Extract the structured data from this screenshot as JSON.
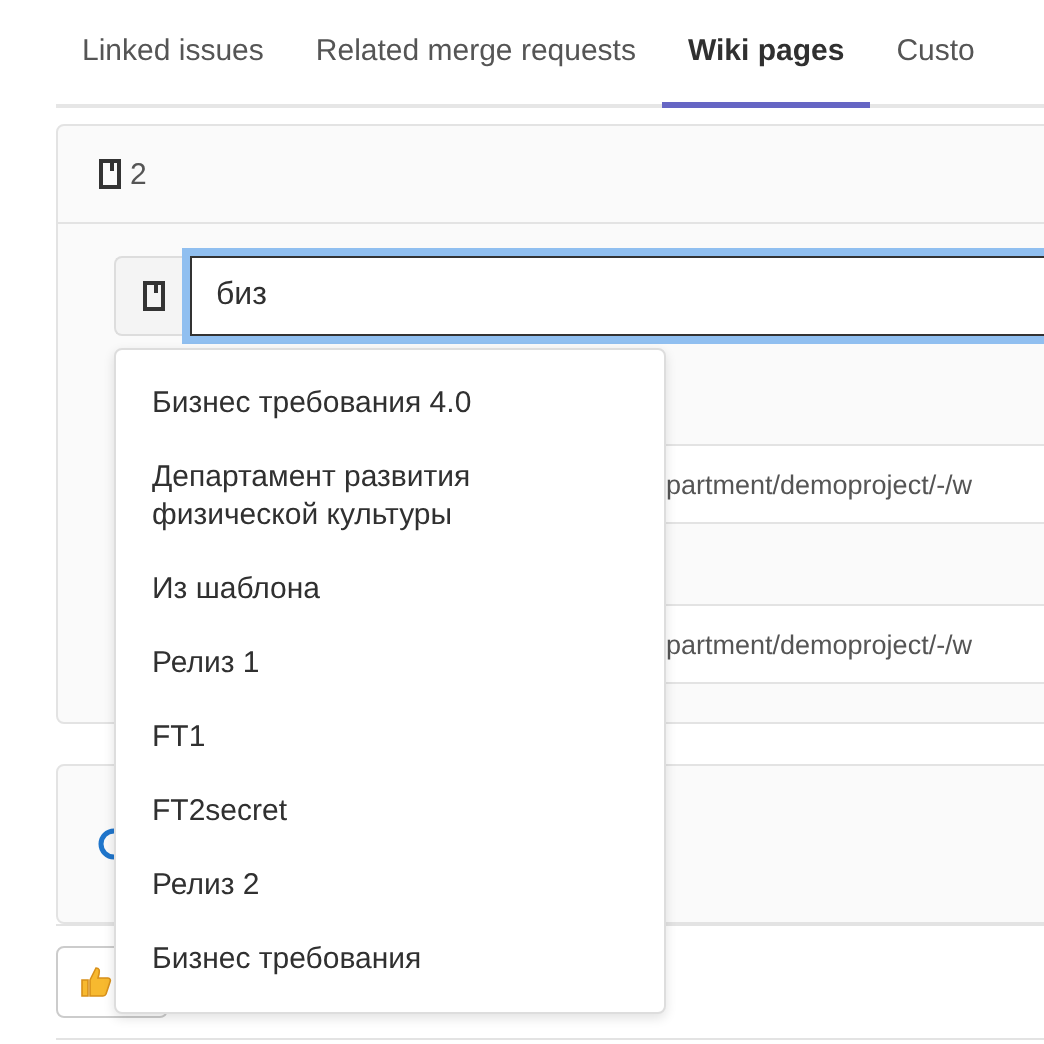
{
  "tabs": [
    {
      "label": "Linked issues",
      "selected": false
    },
    {
      "label": "Related merge requests",
      "selected": false
    },
    {
      "label": "Wiki pages",
      "selected": true
    },
    {
      "label": "Custo",
      "selected": false
    }
  ],
  "wiki_card": {
    "count": "2",
    "search": {
      "value": "биз"
    },
    "suggestions": [
      "Бизнес требования 4.0",
      "Департамент развития физической культуры",
      "Из шаблона",
      "Релиз 1",
      "FT1",
      "FT2secret",
      "Релиз 2",
      "Бизнес требования"
    ],
    "linked_pages": [
      "partment/demoproject/-/w",
      "partment/demoproject/-/w"
    ]
  }
}
